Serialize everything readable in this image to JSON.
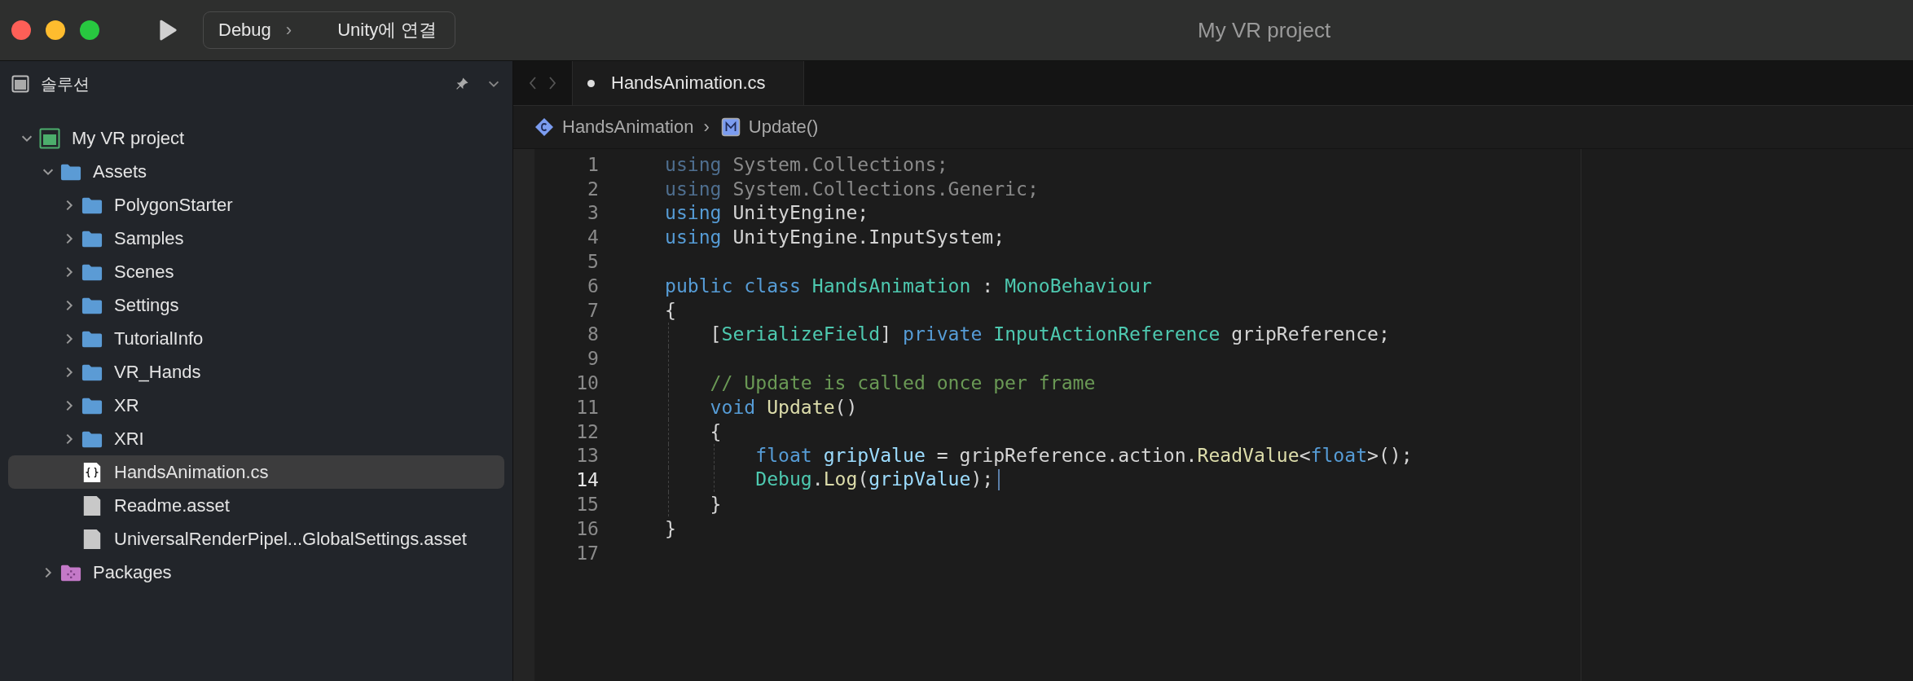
{
  "window": {
    "title": "My VR project"
  },
  "toolbar": {
    "configuration": "Debug",
    "separator": "›",
    "target": "Unity에 연결"
  },
  "sidebar": {
    "title": "솔루션",
    "tree": [
      {
        "label": "My VR project",
        "kind": "project",
        "expanded": true,
        "selected": false,
        "children": [
          {
            "label": "Assets",
            "kind": "folder",
            "expanded": true,
            "selected": false,
            "children": [
              {
                "label": "PolygonStarter",
                "kind": "folder",
                "expanded": false,
                "selected": false
              },
              {
                "label": "Samples",
                "kind": "folder",
                "expanded": false,
                "selected": false
              },
              {
                "label": "Scenes",
                "kind": "folder",
                "expanded": false,
                "selected": false
              },
              {
                "label": "Settings",
                "kind": "folder",
                "expanded": false,
                "selected": false
              },
              {
                "label": "TutorialInfo",
                "kind": "folder",
                "expanded": false,
                "selected": false
              },
              {
                "label": "VR_Hands",
                "kind": "folder",
                "expanded": false,
                "selected": false
              },
              {
                "label": "XR",
                "kind": "folder",
                "expanded": false,
                "selected": false
              },
              {
                "label": "XRI",
                "kind": "folder",
                "expanded": false,
                "selected": false
              },
              {
                "label": "HandsAnimation.cs",
                "kind": "script",
                "selected": true
              },
              {
                "label": "Readme.asset",
                "kind": "file",
                "selected": false
              },
              {
                "label": "UniversalRenderPipel...GlobalSettings.asset",
                "kind": "file",
                "selected": false
              }
            ]
          },
          {
            "label": "Packages",
            "kind": "package",
            "expanded": false,
            "selected": false
          }
        ]
      }
    ]
  },
  "editor": {
    "tabs": [
      {
        "label": "HandsAnimation.cs",
        "selected": true
      }
    ],
    "breadcrumb": [
      {
        "label": "HandsAnimation",
        "kind": "class"
      },
      {
        "label": "Update()",
        "kind": "method"
      }
    ],
    "breadcrumb_separator": "›",
    "lines": [
      {
        "number": "1",
        "current": false,
        "tokens": [
          {
            "text": "using",
            "kind": "kw-dim"
          },
          {
            "text": " System.Collections;",
            "kind": "plain-dim"
          }
        ]
      },
      {
        "number": "2",
        "current": false,
        "tokens": [
          {
            "text": "using",
            "kind": "kw-dim"
          },
          {
            "text": " System.Collections.Generic;",
            "kind": "plain-dim"
          }
        ]
      },
      {
        "number": "3",
        "current": false,
        "tokens": [
          {
            "text": "using",
            "kind": "kw"
          },
          {
            "text": " UnityEngine;",
            "kind": "plain"
          }
        ]
      },
      {
        "number": "4",
        "current": false,
        "tokens": [
          {
            "text": "using",
            "kind": "kw"
          },
          {
            "text": " UnityEngine.InputSystem;",
            "kind": "plain"
          }
        ]
      },
      {
        "number": "5",
        "current": false
      },
      {
        "number": "6",
        "current": false,
        "tokens": [
          {
            "text": "public class",
            "kind": "kw"
          },
          {
            "text": " HandsAnimation",
            "kind": "type"
          },
          {
            "text": " : ",
            "kind": "plain"
          },
          {
            "text": "MonoBehaviour",
            "kind": "type"
          }
        ]
      },
      {
        "number": "7",
        "current": false,
        "tokens": [
          {
            "text": "{",
            "kind": "plain"
          }
        ]
      },
      {
        "number": "8",
        "current": false,
        "tokens": [
          {
            "text": "    [",
            "kind": "plain"
          },
          {
            "text": "SerializeField",
            "kind": "type"
          },
          {
            "text": "] ",
            "kind": "plain"
          },
          {
            "text": "private",
            "kind": "kw"
          },
          {
            "text": " InputActionReference",
            "kind": "type"
          },
          {
            "text": " gripReference;",
            "kind": "plain"
          }
        ]
      },
      {
        "number": "9",
        "current": false
      },
      {
        "number": "10",
        "current": false,
        "tokens": [
          {
            "text": "    // Update is called once per frame",
            "kind": "comment"
          }
        ]
      },
      {
        "number": "11",
        "current": false,
        "tokens": [
          {
            "text": "    void",
            "kind": "kw"
          },
          {
            "text": " Update",
            "kind": "method"
          },
          {
            "text": "()",
            "kind": "plain"
          }
        ]
      },
      {
        "number": "12",
        "current": false,
        "tokens": [
          {
            "text": "    {",
            "kind": "plain"
          }
        ]
      },
      {
        "number": "13",
        "current": false,
        "tokens": [
          {
            "text": "        float",
            "kind": "kw"
          },
          {
            "text": " gripValue",
            "kind": "var"
          },
          {
            "text": " = gripReference.action.",
            "kind": "plain"
          },
          {
            "text": "ReadValue",
            "kind": "method"
          },
          {
            "text": "<",
            "kind": "plain"
          },
          {
            "text": "float",
            "kind": "kw"
          },
          {
            "text": ">();",
            "kind": "plain"
          }
        ]
      },
      {
        "number": "14",
        "current": true,
        "tokens": [
          {
            "text": "        Debug",
            "kind": "type"
          },
          {
            "text": ".",
            "kind": "plain"
          },
          {
            "text": "Log",
            "kind": "method"
          },
          {
            "text": "(",
            "kind": "plain"
          },
          {
            "text": "gripValue",
            "kind": "var"
          },
          {
            "text": ");",
            "kind": "plain"
          }
        ]
      },
      {
        "number": "15",
        "current": false,
        "tokens": [
          {
            "text": "    }",
            "kind": "plain"
          }
        ]
      },
      {
        "number": "16",
        "current": false,
        "tokens": [
          {
            "text": "}",
            "kind": "plain"
          }
        ]
      },
      {
        "number": "17",
        "current": false
      }
    ]
  }
}
